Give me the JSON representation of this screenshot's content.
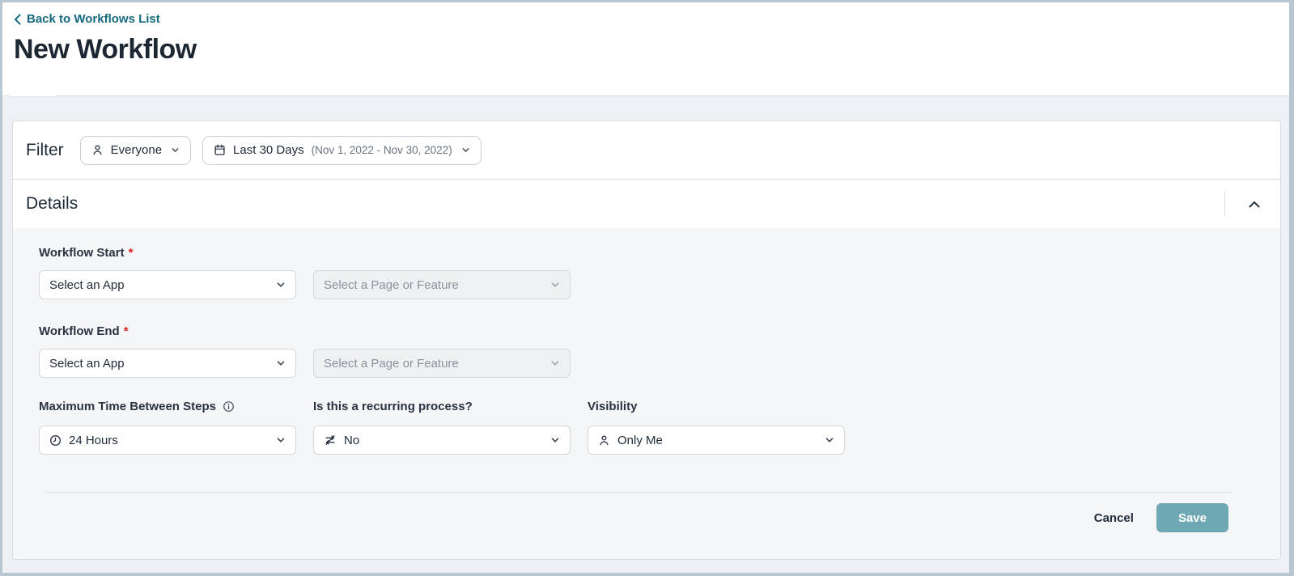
{
  "page": {
    "back_link": "Back to Workflows List",
    "title": "New Workflow"
  },
  "filter": {
    "label": "Filter",
    "audience_value": "Everyone",
    "date_value": "Last 30 Days",
    "date_detail": "(Nov 1, 2022 - Nov 30, 2022)"
  },
  "details": {
    "title": "Details",
    "workflow_start": {
      "label": "Workflow Start",
      "required_mark": "*",
      "app_value": "Select an App",
      "page_value": "Select a Page or Feature"
    },
    "workflow_end": {
      "label": "Workflow End",
      "required_mark": "*",
      "app_value": "Select an App",
      "page_value": "Select a Page or Feature"
    },
    "max_time": {
      "label": "Maximum Time Between Steps",
      "value": "24 Hours"
    },
    "recurring": {
      "label": "Is this a recurring process?",
      "value": "No"
    },
    "visibility": {
      "label": "Visibility",
      "value": "Only Me"
    }
  },
  "footer": {
    "cancel_label": "Cancel",
    "save_label": "Save"
  },
  "icons": {
    "back": "chevron-left-icon",
    "audience": "person-icon",
    "date": "calendar-icon",
    "collapse": "chevron-up-icon",
    "max_time": "clock-icon",
    "recurring": "repeat-off-icon",
    "visibility": "person-icon",
    "info": "info-circle-icon"
  },
  "colors": {
    "accent_link": "#16697E",
    "save_button": "#6FA8B5",
    "required_mark": "#DD2222",
    "frame": "#B9C7D2",
    "section_bg": "#F5F6F8"
  }
}
